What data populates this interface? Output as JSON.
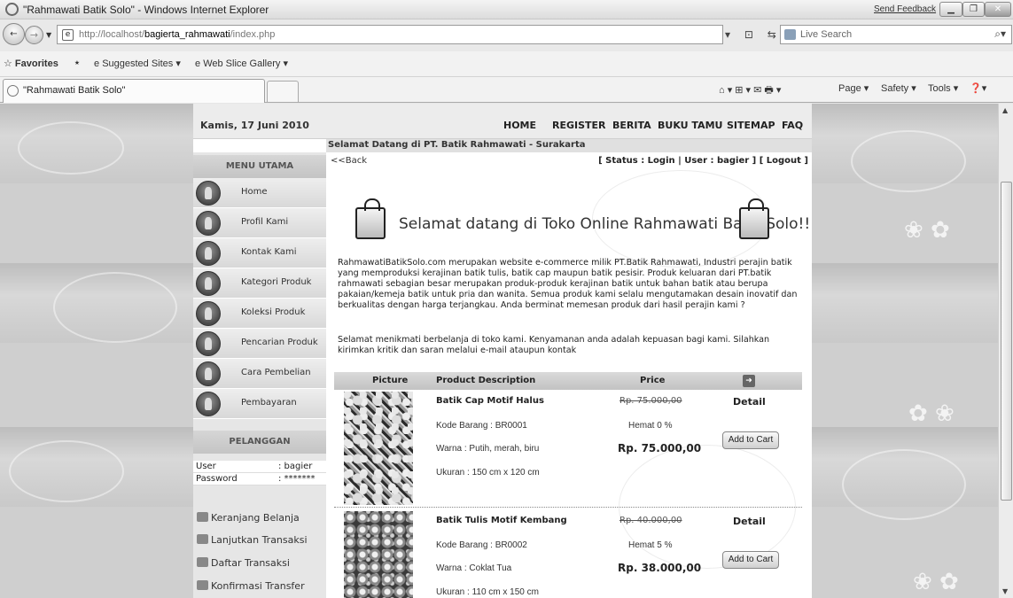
{
  "browser": {
    "window_title": "\"Rahmawati Batik Solo\" - Windows Internet Explorer",
    "send_feedback": "Send Feedback",
    "url_prefix": "http://localhost/",
    "url_host": "bagierta_rahmawati",
    "url_path": "/index.php",
    "search_placeholder": "Live Search",
    "favorites": "Favorites",
    "suggested_sites": "Suggested Sites ▾",
    "web_slice_gallery": "Web Slice Gallery ▾",
    "tab_title": "\"Rahmawati Batik Solo\"",
    "page_menu": "Page ▾",
    "safety_menu": "Safety ▾",
    "tools_menu": "Tools ▾",
    "help_menu": "❓▾"
  },
  "site": {
    "date": "Kamis, 17 Juni 2010",
    "nav": [
      "HOME",
      "REGISTER",
      "BERITA",
      "BUKU TAMU",
      "SITEMAP",
      "FAQ"
    ],
    "welcome": "Selamat Datang di PT. Batik Rahmawati - Surakarta"
  },
  "sidebar": {
    "menu_heading": "MENU UTAMA",
    "items": [
      "Home",
      "Profil Kami",
      "Kontak Kami",
      "Kategori Produk",
      "Koleksi Produk",
      "Pencarian Produk",
      "Cara Pembelian",
      "Pembayaran"
    ],
    "customer_heading": "PELANGGAN",
    "login": [
      {
        "label": "User",
        "value": ": bagier"
      },
      {
        "label": "Password",
        "value": ": *******"
      }
    ],
    "links": [
      "Keranjang Belanja",
      "Lanjutkan Transaksi",
      "Daftar Transaksi",
      "Konfirmasi Transfer"
    ]
  },
  "main": {
    "back": "<<Back",
    "status": "[ Status : Login | User : bagier ] [ Logout ]",
    "hero": "Selamat datang di Toko Online Rahmawati Batik Solo!!",
    "intro": "RahmawatiBatikSolo.com merupakan website e-commerce milik PT.Batik Rahmawati, Industri perajin batik yang memproduksi kerajinan batik tulis, batik cap maupun batik pesisir. Produk keluaran dari PT.batik rahmawati sebagian besar merupakan produk-produk kerajinan batik untuk bahan batik atau berupa pakaian/kemeja batik untuk pria dan wanita. Semua produk kami selalu mengutamakan desain inovatif dan berkualitas dengan harga terjangkau. Anda berminat memesan produk dari hasil perajin kami ?",
    "intro2": "Selamat menikmati berbelanja di toko kami. Kenyamanan anda adalah kepuasan bagi kami. Silahkan kirimkan kritik dan saran melalui e-mail ataupun kontak",
    "table_headers": {
      "picture": "Picture",
      "description": "Product Description",
      "price": "Price"
    },
    "products": [
      {
        "name": "Batik Cap Motif Halus",
        "code": "Kode Barang : BR0001",
        "color": "Warna : Putih, merah, biru",
        "size": "Ukuran : 150 cm x 120 cm",
        "old_price": "Rp. 75.000,00",
        "discount": "Hemat 0 %",
        "price": "Rp. 75.000,00",
        "detail": "Detail",
        "add_to_cart": "Add to Cart"
      },
      {
        "name": "Batik Tulis Motif Kembang",
        "code": "Kode Barang : BR0002",
        "color": "Warna : Coklat Tua",
        "size": "Ukuran : 110 cm x 150 cm",
        "old_price": "Rp. 40.000,00",
        "discount": "Hemat 5 %",
        "price": "Rp. 38.000,00",
        "detail": "Detail",
        "add_to_cart": "Add to Cart"
      }
    ]
  }
}
